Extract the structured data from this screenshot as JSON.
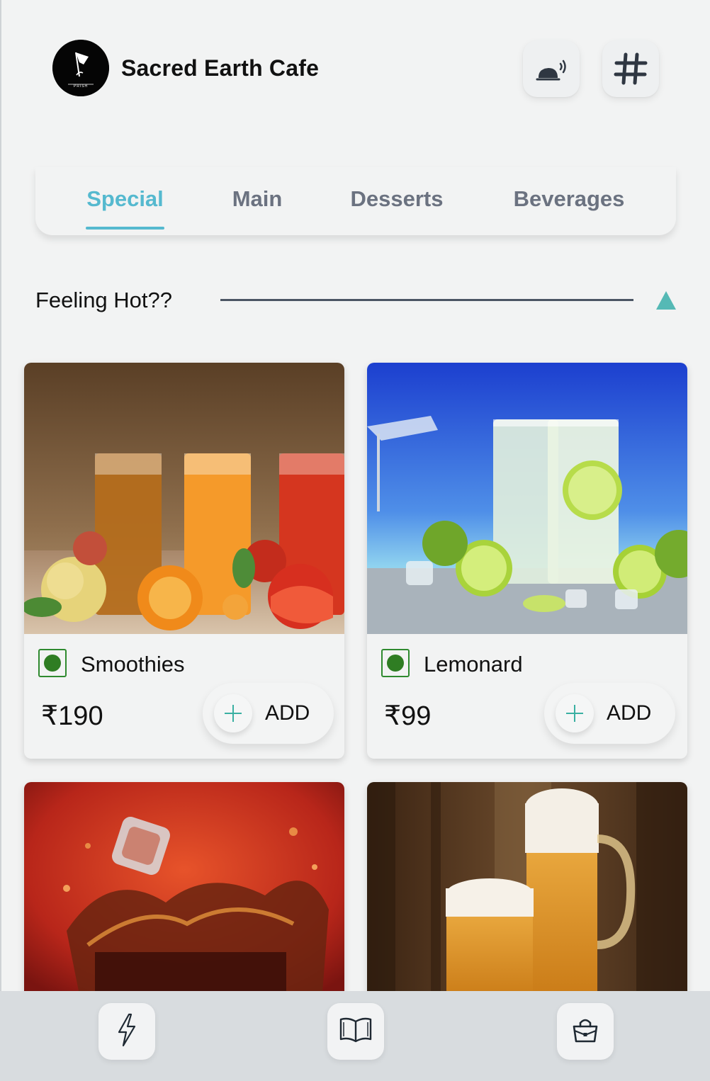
{
  "app": {
    "name": "Sacred Earth Cafe",
    "logo_text": "PRISH"
  },
  "header": {
    "icons": [
      "call-waiter-icon",
      "table-number-icon"
    ]
  },
  "tabs": [
    {
      "label": "Special",
      "active": true
    },
    {
      "label": "Main",
      "active": false
    },
    {
      "label": "Desserts",
      "active": false
    },
    {
      "label": "Beverages",
      "active": false
    }
  ],
  "section": {
    "title": "Feeling Hot??",
    "expanded": true
  },
  "items": [
    {
      "name": "Smoothies",
      "price": "₹190",
      "add_label": "ADD",
      "veg": true,
      "image": "juice-glasses-with-fruits"
    },
    {
      "name": "Lemonard",
      "price": "₹99",
      "add_label": "ADD",
      "veg": true,
      "image": "lemonade-glasses-beach"
    },
    {
      "image": "cola-splash-with-ice"
    },
    {
      "image": "beer-mugs-on-barrels"
    }
  ],
  "bottom_nav": [
    "lightning-icon",
    "menu-book-icon",
    "shopping-bag-icon"
  ],
  "colors": {
    "accent": "#55b9cf",
    "background": "#f2f3f3",
    "veg_green": "#2f7d23",
    "inactive_tab": "#6b7280",
    "bottom_bar": "#d8dcdf"
  }
}
